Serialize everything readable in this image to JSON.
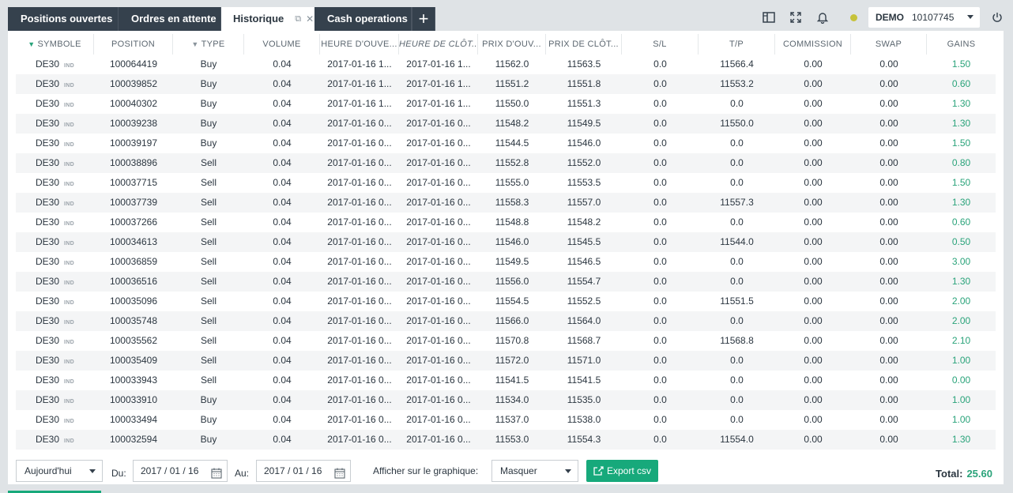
{
  "tabs": [
    {
      "label": "Positions ouvertes"
    },
    {
      "label": "Ordres en attente"
    },
    {
      "label": "Historique"
    },
    {
      "label": "Cash operations"
    }
  ],
  "add_tab_label": "+",
  "account": {
    "type": "DEMO",
    "number": "10107745"
  },
  "status_color": "#c6c23a",
  "accent_color": "#17a97b",
  "columns": [
    "SYMBOLE",
    "POSITION",
    "TYPE",
    "VOLUME",
    "HEURE D'OUVE...",
    "HEURE DE CLÔT...",
    "PRIX D'OUV...",
    "PRIX DE CLÔT...",
    "S/L",
    "T/P",
    "COMMISSION",
    "SWAP",
    "GAINS"
  ],
  "symbol_suffix": "IND",
  "rows": [
    {
      "symbol": "DE30",
      "position": "100064419",
      "type": "Buy",
      "volume": "0.04",
      "open_time": "2017-01-16 1...",
      "close_time": "2017-01-16 1...",
      "open_price": "11562.0",
      "close_price": "11563.5",
      "sl": "0.0",
      "tp": "11566.4",
      "commission": "0.00",
      "swap": "0.00",
      "gain": "1.50"
    },
    {
      "symbol": "DE30",
      "position": "100039852",
      "type": "Buy",
      "volume": "0.04",
      "open_time": "2017-01-16 1...",
      "close_time": "2017-01-16 1...",
      "open_price": "11551.2",
      "close_price": "11551.8",
      "sl": "0.0",
      "tp": "11553.2",
      "commission": "0.00",
      "swap": "0.00",
      "gain": "0.60"
    },
    {
      "symbol": "DE30",
      "position": "100040302",
      "type": "Buy",
      "volume": "0.04",
      "open_time": "2017-01-16 1...",
      "close_time": "2017-01-16 1...",
      "open_price": "11550.0",
      "close_price": "11551.3",
      "sl": "0.0",
      "tp": "0.0",
      "commission": "0.00",
      "swap": "0.00",
      "gain": "1.30"
    },
    {
      "symbol": "DE30",
      "position": "100039238",
      "type": "Buy",
      "volume": "0.04",
      "open_time": "2017-01-16 0...",
      "close_time": "2017-01-16 0...",
      "open_price": "11548.2",
      "close_price": "11549.5",
      "sl": "0.0",
      "tp": "11550.0",
      "commission": "0.00",
      "swap": "0.00",
      "gain": "1.30"
    },
    {
      "symbol": "DE30",
      "position": "100039197",
      "type": "Buy",
      "volume": "0.04",
      "open_time": "2017-01-16 0...",
      "close_time": "2017-01-16 0...",
      "open_price": "11544.5",
      "close_price": "11546.0",
      "sl": "0.0",
      "tp": "0.0",
      "commission": "0.00",
      "swap": "0.00",
      "gain": "1.50"
    },
    {
      "symbol": "DE30",
      "position": "100038896",
      "type": "Sell",
      "volume": "0.04",
      "open_time": "2017-01-16 0...",
      "close_time": "2017-01-16 0...",
      "open_price": "11552.8",
      "close_price": "11552.0",
      "sl": "0.0",
      "tp": "0.0",
      "commission": "0.00",
      "swap": "0.00",
      "gain": "0.80"
    },
    {
      "symbol": "DE30",
      "position": "100037715",
      "type": "Sell",
      "volume": "0.04",
      "open_time": "2017-01-16 0...",
      "close_time": "2017-01-16 0...",
      "open_price": "11555.0",
      "close_price": "11553.5",
      "sl": "0.0",
      "tp": "0.0",
      "commission": "0.00",
      "swap": "0.00",
      "gain": "1.50"
    },
    {
      "symbol": "DE30",
      "position": "100037739",
      "type": "Sell",
      "volume": "0.04",
      "open_time": "2017-01-16 0...",
      "close_time": "2017-01-16 0...",
      "open_price": "11558.3",
      "close_price": "11557.0",
      "sl": "0.0",
      "tp": "11557.3",
      "commission": "0.00",
      "swap": "0.00",
      "gain": "1.30"
    },
    {
      "symbol": "DE30",
      "position": "100037266",
      "type": "Sell",
      "volume": "0.04",
      "open_time": "2017-01-16 0...",
      "close_time": "2017-01-16 0...",
      "open_price": "11548.8",
      "close_price": "11548.2",
      "sl": "0.0",
      "tp": "0.0",
      "commission": "0.00",
      "swap": "0.00",
      "gain": "0.60"
    },
    {
      "symbol": "DE30",
      "position": "100034613",
      "type": "Sell",
      "volume": "0.04",
      "open_time": "2017-01-16 0...",
      "close_time": "2017-01-16 0...",
      "open_price": "11546.0",
      "close_price": "11545.5",
      "sl": "0.0",
      "tp": "11544.0",
      "commission": "0.00",
      "swap": "0.00",
      "gain": "0.50"
    },
    {
      "symbol": "DE30",
      "position": "100036859",
      "type": "Sell",
      "volume": "0.04",
      "open_time": "2017-01-16 0...",
      "close_time": "2017-01-16 0...",
      "open_price": "11549.5",
      "close_price": "11546.5",
      "sl": "0.0",
      "tp": "0.0",
      "commission": "0.00",
      "swap": "0.00",
      "gain": "3.00"
    },
    {
      "symbol": "DE30",
      "position": "100036516",
      "type": "Sell",
      "volume": "0.04",
      "open_time": "2017-01-16 0...",
      "close_time": "2017-01-16 0...",
      "open_price": "11556.0",
      "close_price": "11554.7",
      "sl": "0.0",
      "tp": "0.0",
      "commission": "0.00",
      "swap": "0.00",
      "gain": "1.30"
    },
    {
      "symbol": "DE30",
      "position": "100035096",
      "type": "Sell",
      "volume": "0.04",
      "open_time": "2017-01-16 0...",
      "close_time": "2017-01-16 0...",
      "open_price": "11554.5",
      "close_price": "11552.5",
      "sl": "0.0",
      "tp": "11551.5",
      "commission": "0.00",
      "swap": "0.00",
      "gain": "2.00"
    },
    {
      "symbol": "DE30",
      "position": "100035748",
      "type": "Sell",
      "volume": "0.04",
      "open_time": "2017-01-16 0...",
      "close_time": "2017-01-16 0...",
      "open_price": "11566.0",
      "close_price": "11564.0",
      "sl": "0.0",
      "tp": "0.0",
      "commission": "0.00",
      "swap": "0.00",
      "gain": "2.00"
    },
    {
      "symbol": "DE30",
      "position": "100035562",
      "type": "Sell",
      "volume": "0.04",
      "open_time": "2017-01-16 0...",
      "close_time": "2017-01-16 0...",
      "open_price": "11570.8",
      "close_price": "11568.7",
      "sl": "0.0",
      "tp": "11568.8",
      "commission": "0.00",
      "swap": "0.00",
      "gain": "2.10"
    },
    {
      "symbol": "DE30",
      "position": "100035409",
      "type": "Sell",
      "volume": "0.04",
      "open_time": "2017-01-16 0...",
      "close_time": "2017-01-16 0...",
      "open_price": "11572.0",
      "close_price": "11571.0",
      "sl": "0.0",
      "tp": "0.0",
      "commission": "0.00",
      "swap": "0.00",
      "gain": "1.00"
    },
    {
      "symbol": "DE30",
      "position": "100033943",
      "type": "Sell",
      "volume": "0.04",
      "open_time": "2017-01-16 0...",
      "close_time": "2017-01-16 0...",
      "open_price": "11541.5",
      "close_price": "11541.5",
      "sl": "0.0",
      "tp": "0.0",
      "commission": "0.00",
      "swap": "0.00",
      "gain": "0.00"
    },
    {
      "symbol": "DE30",
      "position": "100033910",
      "type": "Buy",
      "volume": "0.04",
      "open_time": "2017-01-16 0...",
      "close_time": "2017-01-16 0...",
      "open_price": "11534.0",
      "close_price": "11535.0",
      "sl": "0.0",
      "tp": "0.0",
      "commission": "0.00",
      "swap": "0.00",
      "gain": "1.00"
    },
    {
      "symbol": "DE30",
      "position": "100033494",
      "type": "Buy",
      "volume": "0.04",
      "open_time": "2017-01-16 0...",
      "close_time": "2017-01-16 0...",
      "open_price": "11537.0",
      "close_price": "11538.0",
      "sl": "0.0",
      "tp": "0.0",
      "commission": "0.00",
      "swap": "0.00",
      "gain": "1.00"
    },
    {
      "symbol": "DE30",
      "position": "100032594",
      "type": "Buy",
      "volume": "0.04",
      "open_time": "2017-01-16 0...",
      "close_time": "2017-01-16 0...",
      "open_price": "11553.0",
      "close_price": "11554.3",
      "sl": "0.0",
      "tp": "11554.0",
      "commission": "0.00",
      "swap": "0.00",
      "gain": "1.30"
    }
  ],
  "footer": {
    "period": "Aujourd'hui",
    "from_label": "Du:",
    "from_value": "2017 / 01 / 16",
    "to_label": "Au:",
    "to_value": "2017 / 01 / 16",
    "chart_label": "Afficher sur le graphique:",
    "chart_value": "Masquer",
    "export_label": "Export csv",
    "total_label": "Total:",
    "total_value": "25.60"
  }
}
